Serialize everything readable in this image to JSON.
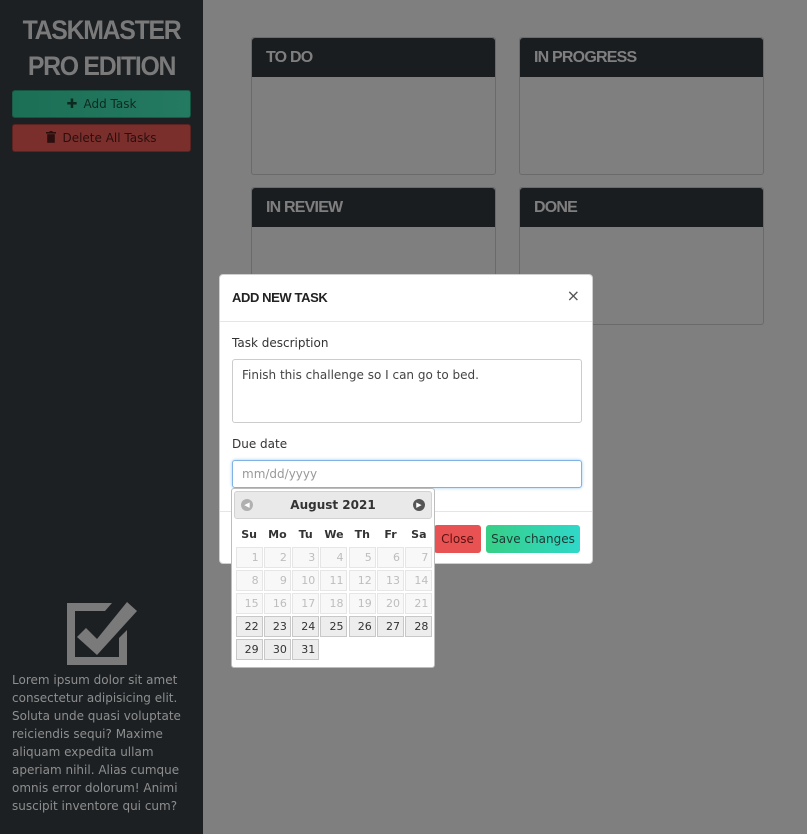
{
  "sidebar": {
    "app_title": "TASKMASTER PRO EDITION",
    "add_task_label": "Add Task",
    "add_icon": "plus-icon",
    "delete_all_label": "Delete All Tasks",
    "delete_icon": "trash-icon",
    "logo_icon": "checkbox-checked-icon",
    "about_text": "Lorem ipsum dolor sit amet consectetur adipisicing elit. Soluta unde quasi voluptate reiciendis sequi? Maxime aliquam expedita ullam aperiam nihil. Alias cumque omnis error dolorum! Animi suscipit inventore qui cum?"
  },
  "board": {
    "columns": [
      {
        "title": "TO DO"
      },
      {
        "title": "IN PROGRESS"
      },
      {
        "title": "IN REVIEW"
      },
      {
        "title": "DONE"
      }
    ]
  },
  "modal": {
    "title": "ADD NEW TASK",
    "close_glyph": "×",
    "description_label": "Task description",
    "description_value": "Finish this challenge so I can go to bed.",
    "due_label": "Due date",
    "due_placeholder": "mm/dd/yyyy",
    "close_button": "Close",
    "save_button": "Save changes"
  },
  "datepicker": {
    "month_title": "August 2021",
    "weekdays": [
      "Su",
      "Mo",
      "Tu",
      "We",
      "Th",
      "Fr",
      "Sa"
    ],
    "weeks": [
      [
        {
          "d": "1",
          "s": "muted"
        },
        {
          "d": "2",
          "s": "muted"
        },
        {
          "d": "3",
          "s": "muted"
        },
        {
          "d": "4",
          "s": "muted"
        },
        {
          "d": "5",
          "s": "muted"
        },
        {
          "d": "6",
          "s": "muted"
        },
        {
          "d": "7",
          "s": "muted"
        }
      ],
      [
        {
          "d": "8",
          "s": "muted"
        },
        {
          "d": "9",
          "s": "muted"
        },
        {
          "d": "10",
          "s": "muted"
        },
        {
          "d": "11",
          "s": "muted"
        },
        {
          "d": "12",
          "s": "muted"
        },
        {
          "d": "13",
          "s": "muted"
        },
        {
          "d": "14",
          "s": "muted"
        }
      ],
      [
        {
          "d": "15",
          "s": "muted"
        },
        {
          "d": "16",
          "s": "muted"
        },
        {
          "d": "17",
          "s": "muted"
        },
        {
          "d": "18",
          "s": "muted"
        },
        {
          "d": "19",
          "s": "muted"
        },
        {
          "d": "20",
          "s": "muted"
        },
        {
          "d": "21",
          "s": "muted"
        }
      ],
      [
        {
          "d": "22",
          "s": "active"
        },
        {
          "d": "23",
          "s": "active"
        },
        {
          "d": "24",
          "s": "active"
        },
        {
          "d": "25",
          "s": "active"
        },
        {
          "d": "26",
          "s": "active"
        },
        {
          "d": "27",
          "s": "active"
        },
        {
          "d": "28",
          "s": "active"
        }
      ],
      [
        {
          "d": "29",
          "s": "active"
        },
        {
          "d": "30",
          "s": "active"
        },
        {
          "d": "31",
          "s": "active"
        }
      ]
    ],
    "prev_icon": "chevron-left-icon",
    "next_icon": "chevron-right-icon"
  },
  "colors": {
    "sidebar_bg": "#1c2023",
    "add_button": "#1b6f55",
    "delete_button": "#7b2f2c",
    "column_header": "#343a40",
    "close_button": "#e85252",
    "save_button_start": "#37cf86",
    "save_button_end": "#2fd8c9"
  }
}
